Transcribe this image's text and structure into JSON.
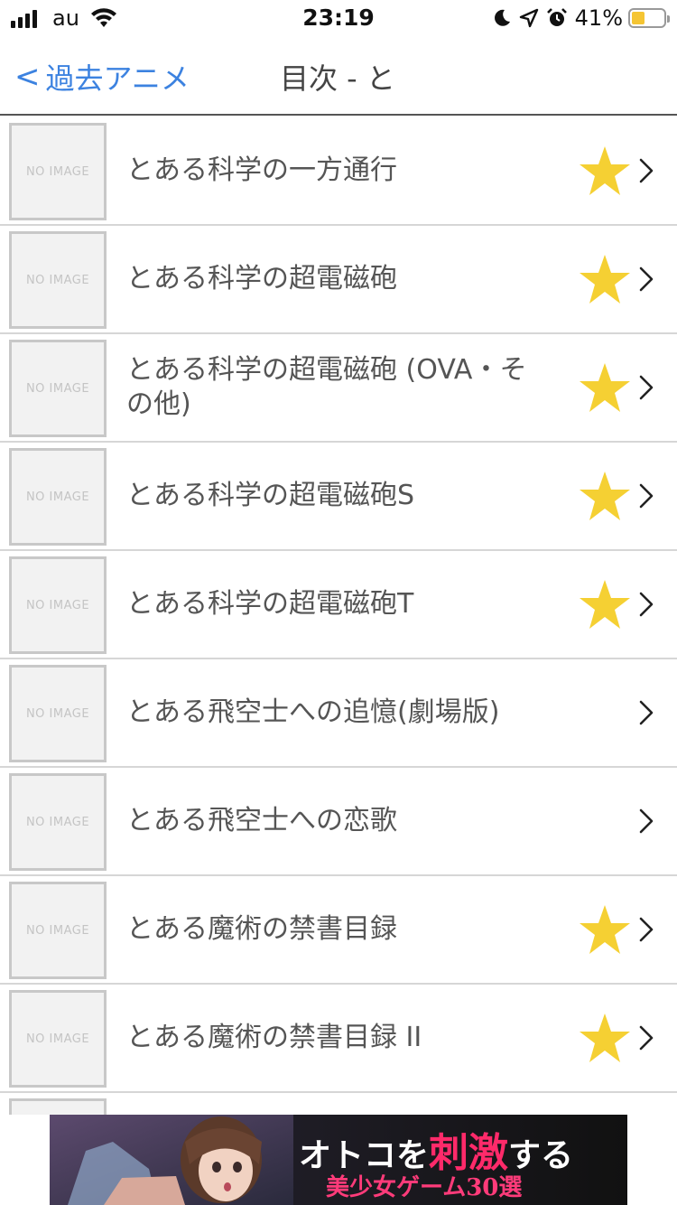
{
  "status_bar": {
    "carrier": "au",
    "time": "23:19",
    "battery_percent": "41%",
    "battery_level": 0.41
  },
  "nav": {
    "back_label": "過去アニメ",
    "title": "目次 - と"
  },
  "thumb_placeholder": "NO IMAGE",
  "items": [
    {
      "title": "とある科学の一方通行",
      "favorite": true
    },
    {
      "title": "とある科学の超電磁砲",
      "favorite": true
    },
    {
      "title": "とある科学の超電磁砲 (OVA・その他)",
      "favorite": true
    },
    {
      "title": "とある科学の超電磁砲S",
      "favorite": true
    },
    {
      "title": "とある科学の超電磁砲T",
      "favorite": true
    },
    {
      "title": "とある飛空士への追憶(劇場版)",
      "favorite": false
    },
    {
      "title": "とある飛空士への恋歌",
      "favorite": false
    },
    {
      "title": "とある魔術の禁書目録",
      "favorite": true
    },
    {
      "title": "とある魔術の禁書目録 II",
      "favorite": true
    }
  ],
  "ad": {
    "line1_a": "オトコを",
    "line1_highlight": "刺激",
    "line1_b": "する",
    "line2": "美少女ゲーム30選"
  },
  "colors": {
    "accent": "#3c82e0",
    "star": "#f5d033",
    "ad_highlight": "#ff2a6a"
  }
}
